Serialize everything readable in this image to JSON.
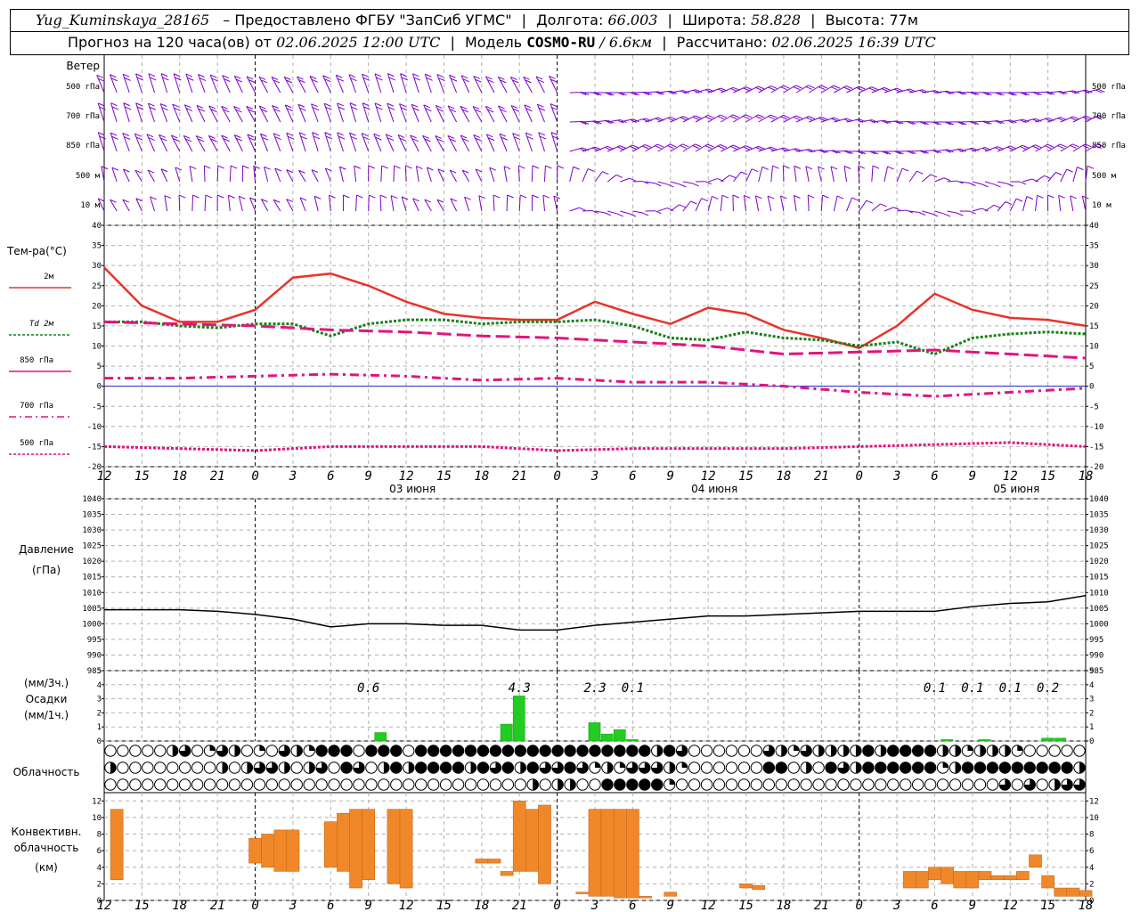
{
  "header": {
    "station": "Yug_Kuminskaya_28165",
    "provider": "– Предоставлено ФГБУ \"ЗапСиб УГМС\"",
    "lon_label": "Долгота:",
    "lon_value": "66.003",
    "lat_label": "Широта:",
    "lat_value": "58.828",
    "alt_label": "Высота:",
    "alt_value": "77м",
    "forecast_label": "Прогноз на 120 часа(ов) от",
    "forecast_from": "02.06.2025 12:00 UTC",
    "model_label": "Модель",
    "model_name": "COSMO-RU",
    "model_res": "/ 6.6км",
    "calc_label": "Рассчитано:",
    "calc_time": "02.06.2025 16:39 UTC"
  },
  "x_axis": {
    "hour_labels": [
      "12",
      "15",
      "18",
      "21",
      "0",
      "3",
      "6",
      "9",
      "12",
      "15",
      "18",
      "21",
      "0",
      "3",
      "6",
      "9",
      "12",
      "15",
      "18",
      "21",
      "0",
      "3",
      "6",
      "9",
      "12",
      "15",
      "18"
    ],
    "day_labels": [
      {
        "hour": 24,
        "label": "03 июня"
      },
      {
        "hour": 48,
        "label": "04 июня"
      },
      {
        "hour": 72,
        "label": "05 июня"
      }
    ]
  },
  "wind_panel": {
    "title": "Ветер",
    "levels": [
      "500 гПа",
      "700 гПа",
      "850 гПа",
      "500 м",
      "10 м"
    ],
    "color": "#7b00cc"
  },
  "temp_panel": {
    "title": "Тем-ра(°C)",
    "legend": [
      {
        "label": "2м",
        "color": "#e8342a"
      },
      {
        "label": "Td  2м",
        "color": "#1a7f1a"
      },
      {
        "label": "850 гПа",
        "color": "#e0157e"
      },
      {
        "label": "700 гПа",
        "color": "#e0157e"
      },
      {
        "label": "500 гПа",
        "color": "#e0157e"
      }
    ],
    "y_ticks": [
      "40",
      "35",
      "30",
      "25",
      "20",
      "15",
      "10",
      "5",
      "0",
      "-5",
      "-10",
      "-15",
      "-20"
    ]
  },
  "pressure_panel": {
    "title": "Давление",
    "unit": "(гПа)",
    "y_ticks": [
      "1040",
      "1035",
      "1030",
      "1025",
      "1020",
      "1015",
      "1010",
      "1005",
      "1000",
      "995",
      "990",
      "985"
    ]
  },
  "precip_panel": {
    "unit_top": "(мм/3ч.)",
    "title": "Осадки",
    "unit_bottom": "(мм/1ч.)",
    "y_ticks": [
      "5",
      "4",
      "3",
      "2",
      "1",
      "0"
    ],
    "totals": [
      {
        "hour": 21,
        "label": "0.6"
      },
      {
        "hour": 33,
        "label": "4.3"
      },
      {
        "hour": 39,
        "label": "2.3"
      },
      {
        "hour": 42,
        "label": "0.1"
      },
      {
        "hour": 66,
        "label": "0.1"
      },
      {
        "hour": 69,
        "label": "0.1"
      },
      {
        "hour": 72,
        "label": "0.1"
      },
      {
        "hour": 75,
        "label": "0.2"
      }
    ]
  },
  "cloud_panel": {
    "title": "Облачность"
  },
  "conv_panel": {
    "title_1": "Конвективн.",
    "title_2": "облачность",
    "unit": "(км)",
    "y_ticks": [
      "12",
      "10",
      "8",
      "6",
      "4",
      "2",
      "0"
    ]
  },
  "chart_data": [
    {
      "type": "line",
      "title": "Тем-ра(°C)",
      "x_unit": "hours from 02.06.2025 12:00 UTC",
      "ylim": [
        -20,
        40
      ],
      "series": [
        {
          "name": "2м",
          "x": [
            0,
            3,
            6,
            9,
            12,
            15,
            18,
            21,
            24,
            27,
            30,
            33,
            36,
            39,
            42,
            45,
            48,
            51,
            54,
            57,
            60,
            63,
            66,
            69,
            72,
            75,
            78
          ],
          "values": [
            29.5,
            20,
            16,
            16,
            19,
            27,
            28,
            25,
            21,
            18,
            17,
            16.5,
            16.5,
            21,
            18,
            15.5,
            19.5,
            18,
            14,
            12,
            9.5,
            15,
            23,
            19,
            17,
            16.5,
            15
          ]
        },
        {
          "name": "Td  2м",
          "x": [
            0,
            3,
            6,
            9,
            12,
            15,
            18,
            21,
            24,
            27,
            30,
            33,
            36,
            39,
            42,
            45,
            48,
            51,
            54,
            57,
            60,
            63,
            66,
            69,
            72,
            75,
            78
          ],
          "values": [
            16,
            16,
            15,
            14.5,
            15.5,
            15.5,
            12.5,
            15.5,
            16.5,
            16.5,
            15.5,
            16,
            16,
            16.5,
            15,
            12,
            11.5,
            13.5,
            12,
            11.5,
            10,
            11,
            8,
            12,
            13,
            13.5,
            13
          ]
        },
        {
          "name": "850 гПа",
          "x": [
            0,
            6,
            12,
            18,
            24,
            30,
            36,
            42,
            48,
            54,
            60,
            66,
            72,
            78
          ],
          "values": [
            16,
            15.5,
            15,
            14,
            13.5,
            12.5,
            12,
            11,
            10,
            8,
            8.5,
            9,
            8,
            7
          ]
        },
        {
          "name": "700 гПа",
          "x": [
            0,
            6,
            12,
            18,
            24,
            30,
            36,
            42,
            48,
            54,
            60,
            66,
            72,
            78
          ],
          "values": [
            2,
            2,
            2.5,
            3,
            2.5,
            1.5,
            2,
            1,
            1,
            0,
            -1.5,
            -2.5,
            -1.5,
            -0.5
          ]
        },
        {
          "name": "500 гПа",
          "x": [
            0,
            6,
            12,
            18,
            24,
            30,
            36,
            42,
            48,
            54,
            60,
            66,
            72,
            78
          ],
          "values": [
            -15,
            -15.5,
            -16,
            -15,
            -15,
            -15,
            -16,
            -15.5,
            -15.5,
            -15.5,
            -15,
            -14.5,
            -14,
            -15
          ]
        }
      ]
    },
    {
      "type": "line",
      "title": "Давление",
      "ylim": [
        985,
        1040
      ],
      "series": [
        {
          "x": [
            0,
            3,
            6,
            9,
            12,
            15,
            18,
            21,
            24,
            27,
            30,
            33,
            36,
            39,
            42,
            45,
            48,
            51,
            54,
            57,
            60,
            63,
            66,
            69,
            72,
            75,
            78
          ],
          "values": [
            1004.5,
            1004.5,
            1004.5,
            1004,
            1003,
            1001.5,
            999,
            1000,
            1000,
            999.5,
            999.5,
            998,
            998,
            999.5,
            1000.5,
            1001.5,
            1002.5,
            1002.5,
            1003,
            1003.5,
            1004,
            1004,
            1004,
            1005.5,
            1006.5,
            1007,
            1009
          ]
        }
      ]
    },
    {
      "type": "bar",
      "title": "Осадки",
      "ylim": [
        0,
        5
      ],
      "series": [
        {
          "x": [
            22,
            32,
            33,
            39,
            40,
            41,
            42,
            67,
            70,
            75,
            76
          ],
          "values": [
            0.6,
            1.2,
            3.2,
            1.3,
            0.5,
            0.8,
            0.1,
            0.1,
            0.1,
            0.2,
            0.2
          ]
        }
      ]
    },
    {
      "type": "bar",
      "title": "Конвективн. облачность",
      "ylim": [
        0,
        13
      ],
      "bars": [
        {
          "x": 1,
          "bottom": 2.5,
          "top": 11
        },
        {
          "x": 12,
          "bottom": 4.5,
          "top": 7.5
        },
        {
          "x": 13,
          "bottom": 4,
          "top": 8
        },
        {
          "x": 14,
          "bottom": 3.5,
          "top": 8.5
        },
        {
          "x": 15,
          "bottom": 3.5,
          "top": 8.5
        },
        {
          "x": 18,
          "bottom": 4,
          "top": 9.5
        },
        {
          "x": 19,
          "bottom": 3.5,
          "top": 10.5
        },
        {
          "x": 20,
          "bottom": 1.5,
          "top": 11
        },
        {
          "x": 21,
          "bottom": 2.5,
          "top": 11
        },
        {
          "x": 23,
          "bottom": 2,
          "top": 11
        },
        {
          "x": 24,
          "bottom": 1.5,
          "top": 11
        },
        {
          "x": 30,
          "bottom": 4.5,
          "top": 5
        },
        {
          "x": 31,
          "bottom": 4.5,
          "top": 5
        },
        {
          "x": 32,
          "bottom": 3,
          "top": 3.5
        },
        {
          "x": 33,
          "bottom": 3.5,
          "top": 12
        },
        {
          "x": 34,
          "bottom": 3.5,
          "top": 11
        },
        {
          "x": 35,
          "bottom": 2,
          "top": 11.5
        },
        {
          "x": 38,
          "bottom": 0.8,
          "top": 1
        },
        {
          "x": 39,
          "bottom": 0.5,
          "top": 11
        },
        {
          "x": 40,
          "bottom": 0.5,
          "top": 11
        },
        {
          "x": 41,
          "bottom": 0.3,
          "top": 11
        },
        {
          "x": 42,
          "bottom": 0.3,
          "top": 11
        },
        {
          "x": 43,
          "bottom": 0.3,
          "top": 0.5
        },
        {
          "x": 45,
          "bottom": 0.5,
          "top": 1
        },
        {
          "x": 51,
          "bottom": 1.5,
          "top": 2
        },
        {
          "x": 52,
          "bottom": 1.3,
          "top": 1.8
        },
        {
          "x": 64,
          "bottom": 1.5,
          "top": 3.5
        },
        {
          "x": 65,
          "bottom": 1.5,
          "top": 3.5
        },
        {
          "x": 66,
          "bottom": 2.5,
          "top": 4
        },
        {
          "x": 67,
          "bottom": 2,
          "top": 4
        },
        {
          "x": 68,
          "bottom": 1.5,
          "top": 3.5
        },
        {
          "x": 69,
          "bottom": 1.5,
          "top": 3.5
        },
        {
          "x": 70,
          "bottom": 2.5,
          "top": 3.5
        },
        {
          "x": 71,
          "bottom": 2.5,
          "top": 3
        },
        {
          "x": 72,
          "bottom": 2.5,
          "top": 3
        },
        {
          "x": 73,
          "bottom": 2.5,
          "top": 3.5
        },
        {
          "x": 74,
          "bottom": 4,
          "top": 5.5
        },
        {
          "x": 75,
          "bottom": 1.5,
          "top": 3
        },
        {
          "x": 76,
          "bottom": 0.5,
          "top": 1.5
        },
        {
          "x": 77,
          "bottom": 0.5,
          "top": 1.5
        },
        {
          "x": 78,
          "bottom": 0.5,
          "top": 1.2
        }
      ]
    }
  ]
}
